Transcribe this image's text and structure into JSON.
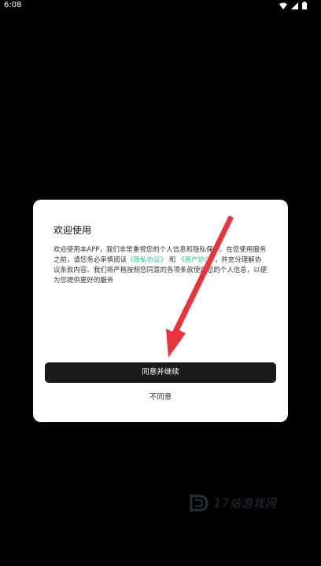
{
  "status_bar": {
    "time": "6:08",
    "icons": [
      "wifi-icon",
      "signal-icon",
      "battery-icon"
    ]
  },
  "dialog": {
    "title": "欢迎使用",
    "body_part1": "欢迎使用本APP，我们非常重视您的个人信息和隐私保护。在您使用服务之前，请您务必审慎阅读",
    "privacy_link": "《隐私协议》",
    "and_text": "和",
    "user_link": "《用户协议》",
    "body_part2": "，并充分理解协议条款内容。我们将严格按照您同意的各项条款使用您的个人信息，以便为您提供更好的服务",
    "agree_button": "同意并继续",
    "disagree_button": "不同意"
  },
  "watermark": {
    "text": "17站游戏网"
  },
  "colors": {
    "background": "#000000",
    "dialog_bg": "#ffffff",
    "primary_button": "#1a1a1a",
    "link": "#2fbf8f",
    "arrow": "#e8343f"
  }
}
